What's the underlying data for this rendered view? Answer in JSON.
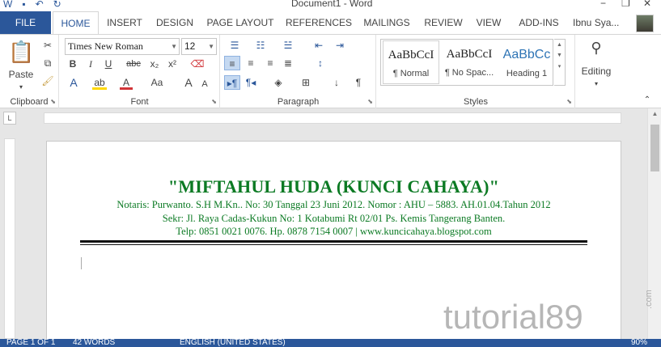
{
  "window": {
    "title": "Document1 - Word",
    "minimize": "−",
    "restore": "❐",
    "close": "✕"
  },
  "tabs": [
    {
      "label": "FILE"
    },
    {
      "label": "HOME"
    },
    {
      "label": "INSERT"
    },
    {
      "label": "DESIGN"
    },
    {
      "label": "PAGE LAYOUT"
    },
    {
      "label": "REFERENCES"
    },
    {
      "label": "MAILINGS"
    },
    {
      "label": "REVIEW"
    },
    {
      "label": "VIEW"
    },
    {
      "label": "ADD-INS"
    }
  ],
  "user": {
    "name": "Ibnu Sya..."
  },
  "ribbon": {
    "clipboard": {
      "label": "Clipboard",
      "paste": "Paste"
    },
    "font": {
      "label": "Font",
      "name": "Times New Roman",
      "size": "12",
      "bold": "B",
      "italic": "I",
      "underline": "U",
      "strike": "abc",
      "subscript": "x₂",
      "superscript": "x²",
      "case": "Aa",
      "grow": "A",
      "shrink": "A"
    },
    "paragraph": {
      "label": "Paragraph"
    },
    "styles": {
      "label": "Styles",
      "items": [
        {
          "sample": "AaBbCcI",
          "name": "¶ Normal"
        },
        {
          "sample": "AaBbCcI",
          "name": "¶ No Spac..."
        },
        {
          "sample": "AaBbCc",
          "name": "Heading 1"
        }
      ]
    },
    "editing": {
      "label": "Editing"
    }
  },
  "document": {
    "title": "\"MIFTAHUL HUDA (KUNCI CAHAYA)\"",
    "lines": [
      "Notaris: Purwanto. S.H M.Kn.. No: 30 Tanggal 23 Juni 2012. Nomor : AHU – 5883. AH.01.04.Tahun 2012",
      "Sekr: Jl. Raya Cadas-Kukun No: 1 Kotabumi Rt 02/01 Ps. Kemis Tangerang Banten.",
      "Telp: 0851 0021 0076. Hp. 0878 7154 0007  |  www.kuncicahaya.blogspot.com"
    ]
  },
  "status": {
    "page": "PAGE 1 OF 1",
    "words": "42 WORDS",
    "language": "ENGLISH (UNITED STATES)",
    "zoom": "90%"
  },
  "watermark": {
    "text": "tutorial89",
    "suffix": ".com"
  },
  "colors": {
    "accent": "#2b579a",
    "letterhead": "#0b7a23"
  }
}
